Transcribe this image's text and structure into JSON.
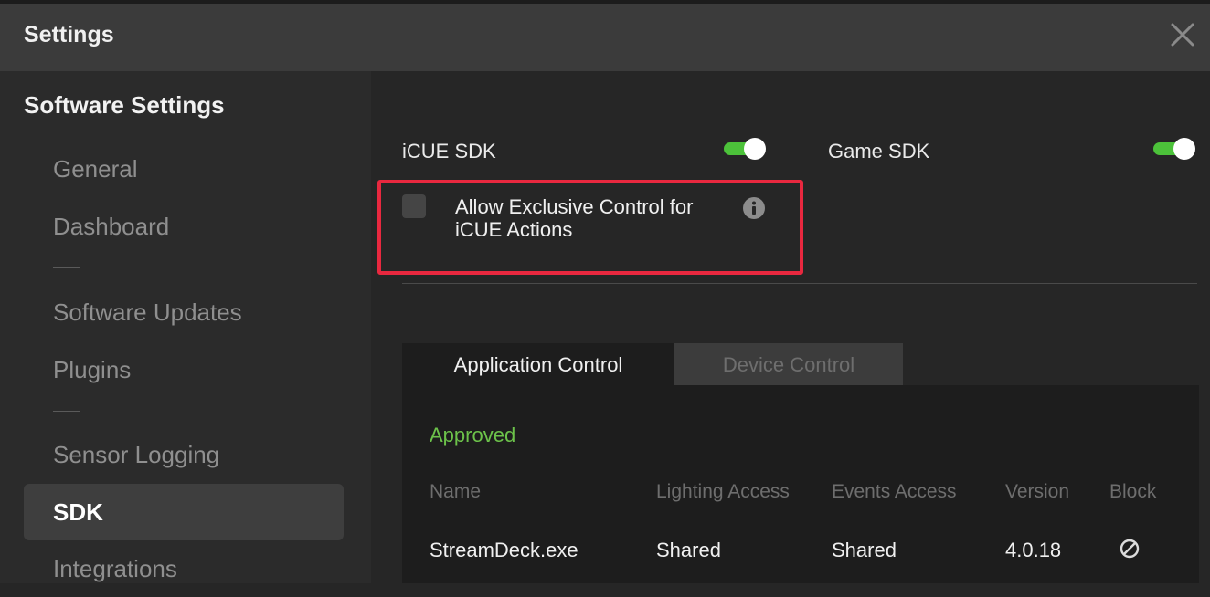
{
  "window": {
    "title": "Settings"
  },
  "sidebar": {
    "heading": "Software Settings",
    "items": [
      {
        "label": "General"
      },
      {
        "label": "Dashboard"
      },
      {
        "label": "Software Updates"
      },
      {
        "label": "Plugins"
      },
      {
        "label": "Sensor Logging"
      },
      {
        "label": "SDK",
        "active": true
      },
      {
        "label": "Integrations"
      }
    ]
  },
  "sdk": {
    "icue_sdk": {
      "label": "iCUE SDK",
      "enabled": true
    },
    "game_sdk": {
      "label": "Game SDK",
      "enabled": true
    },
    "exclusive_control": {
      "label": "Allow Exclusive Control for iCUE Actions",
      "checked": false
    }
  },
  "tabs": [
    {
      "label": "Application Control",
      "active": true
    },
    {
      "label": "Device Control",
      "active": false
    }
  ],
  "table": {
    "section": "Approved",
    "columns": [
      "Name",
      "Lighting Access",
      "Events Access",
      "Version",
      "Block"
    ],
    "rows": [
      {
        "name": "StreamDeck.exe",
        "lighting": "Shared",
        "events": "Shared",
        "version": "4.0.18"
      }
    ]
  },
  "icons": {
    "close": "close-icon",
    "info": "info-icon",
    "block": "block-icon"
  },
  "colors": {
    "toggle_on": "#4cc23a",
    "approved": "#6cc24a",
    "highlight": "#e8283f",
    "active_nav": "#3e3e3e"
  }
}
